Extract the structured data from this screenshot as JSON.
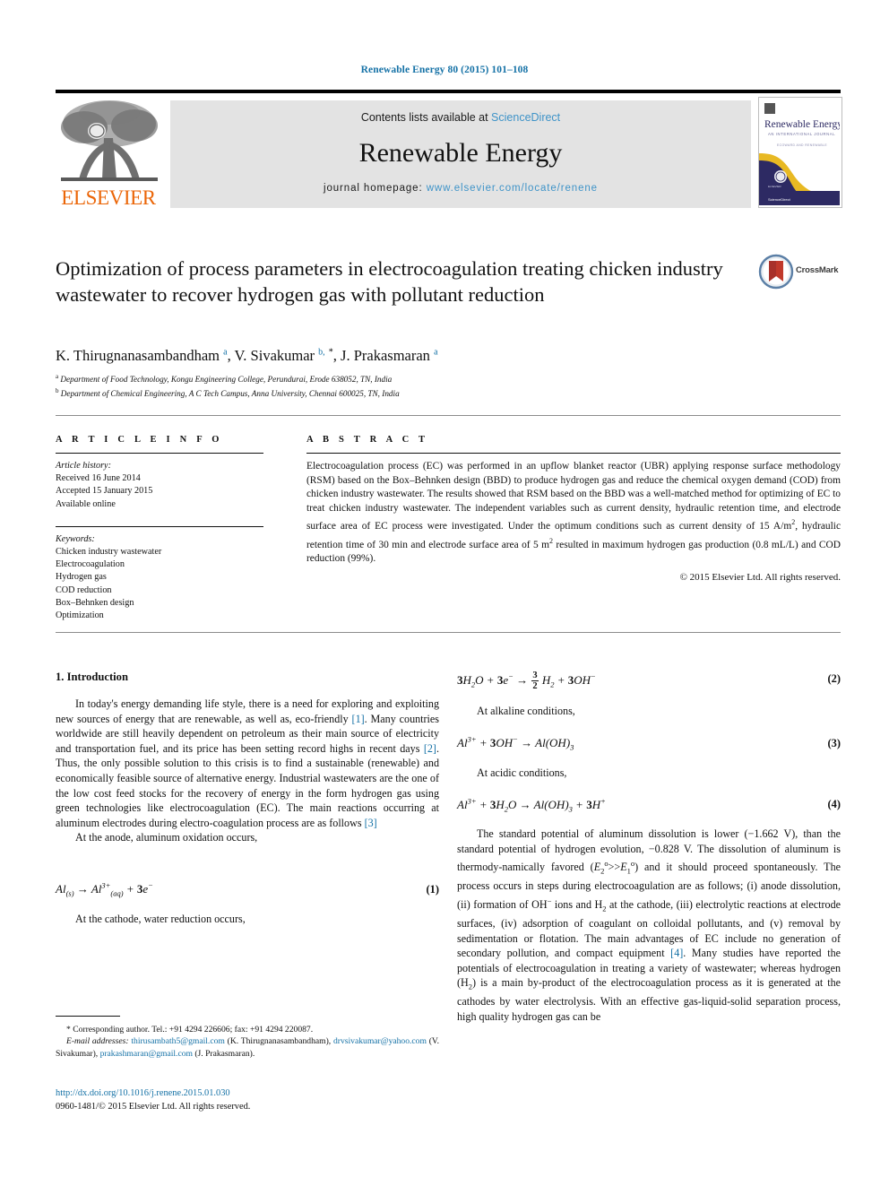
{
  "running_head": "Renewable Energy 80 (2015) 101–108",
  "masthead": {
    "publisher_name": "ELSEVIER",
    "contents_prefix": "Contents lists available at ",
    "sciencedirect": "ScienceDirect",
    "journal_title": "Renewable Energy",
    "homepage_prefix": "journal homepage: ",
    "homepage_url": "www.elsevier.com/locate/renene",
    "cover_title": "Renewable Energy",
    "cover_subtitle": "AN INTERNATIONAL JOURNAL",
    "cover_tagline": "ECOWARD AND RENEWABLE",
    "cover_footer": "ScienceDirect"
  },
  "article": {
    "title": "Optimization of process parameters in electrocoagulation treating chicken industry wastewater to recover hydrogen gas with pollutant reduction",
    "crossmark_label": "CrossMark",
    "authors_html": "K. Thirugnanasambandham <sup>a</sup>, V. Sivakumar <sup>b,</sup> <sup class=\"star\">*</sup>, J. Prakasmaran <sup>a</sup>",
    "affiliations": [
      {
        "marker": "a",
        "text": "Department of Food Technology, Kongu Engineering College, Perundurai, Erode 638052, TN, India"
      },
      {
        "marker": "b",
        "text": "Department of Chemical Engineering, A C Tech Campus, Anna University, Chennai 600025, TN, India"
      }
    ]
  },
  "article_info": {
    "heading": "A R T I C L E  I N F O",
    "history_label": "Article history:",
    "history": [
      "Received 16 June 2014",
      "Accepted 15 January 2015",
      "Available online"
    ],
    "keywords_label": "Keywords:",
    "keywords": [
      "Chicken industry wastewater",
      "Electrocoagulation",
      "Hydrogen gas",
      "COD reduction",
      "Box–Behnken design",
      "Optimization"
    ]
  },
  "abstract": {
    "heading": "A B S T R A C T",
    "body_html": "Electrocoagulation process (EC) was performed in an upflow blanket reactor (UBR) applying response surface methodology (RSM) based on the Box–Behnken design (BBD) to produce hydrogen gas and reduce the chemical oxygen demand (COD) from chicken industry wastewater. The results showed that RSM based on the BBD was a well-matched method for optimizing of EC to treat chicken industry wastewater. The independent variables such as current density, hydraulic retention time, and electrode surface area of EC process were investigated. Under the optimum conditions such as current density of 15 A/m<sup>2</sup>, hydraulic retention time of 30 min and electrode surface area of 5 m<sup>2</sup> resulted in maximum hydrogen gas production (0.8 mL/L) and COD reduction (99%).",
    "copyright": "© 2015 Elsevier Ltd. All rights reserved."
  },
  "body": {
    "section_heading": "1. Introduction",
    "intro_p1_html": "In today's energy demanding life style, there is a need for exploring and exploiting new sources of energy that are renewable, as well as, eco-friendly <span class=\"ref\">[1]</span>. Many countries worldwide are still heavily dependent on petroleum as their main source of electricity and transportation fuel, and its price has been setting record highs in recent days <span class=\"ref\">[2]</span>. Thus, the only possible solution to this crisis is to find a sustainable (renewable) and economically feasible source of alternative energy. Industrial wastewaters are the one of the low cost feed stocks for the recovery of energy in the form hydrogen gas using green technologies like electrocoagulation (EC). The main reactions occurring at aluminum electrodes during electro-coagulation process are as follows <span class=\"ref\">[3]</span>",
    "anode_lead": "At the anode, aluminum oxidation occurs,",
    "cathode_lead": "At the cathode, water reduction occurs,",
    "alkaline_lead": "At alkaline conditions,",
    "acidic_lead": "At acidic conditions,",
    "right_p_html": "The standard potential of aluminum dissolution is lower (−1.662 V), than the standard potential of hydrogen evolution, −0.828 V. The dissolution of aluminum is thermody-namically favored (<i>E</i><sub>2</sub><sup>o</sup>&gt;&gt;<i>E</i><sub>1</sub><sup>o</sup>) and it should proceed spontaneously. The process occurs in steps during electrocoagulation are as follows; (i) anode dissolution, (ii) formation of OH<sup>−</sup> ions and H<sub>2</sub> at the cathode, (iii) electrolytic reactions at electrode surfaces, (iv) adsorption of coagulant on colloidal pollutants, and (v) removal by sedimentation or flotation. The main advantages of EC include no generation of secondary pollution, and compact equipment <span class=\"ref\">[4]</span>. Many studies have reported the potentials of electrocoagulation in treating a variety of wastewater; whereas hydrogen (H<sub>2</sub>) is a main by-product of the electrocoagulation process as it is generated at the cathodes by water electrolysis. With an effective gas-liquid-solid separation process, high quality hydrogen gas can be"
  },
  "equations": [
    {
      "number": "(1)",
      "html": "<i>Al</i><sub>(<i>s</i>)</sub> &#8594; <i>Al</i><sup>3+</sup><sub>(<i>aq</i>)</sub> + <b>3</b><i>e</i><sup>−</sup>"
    },
    {
      "number": "(2)",
      "html": "<b>3</b><i>H</i><sub>2</sub><i>O</i> + <b>3</b><i>e</i><sup>−</sup> &#8594; <span class=\"frac\"><span class=\"num\">3</span><span class=\"den\">2</span></span> <i>H</i><sub>2</sub> + <b>3</b><i>OH</i><sup>−</sup>"
    },
    {
      "number": "(3)",
      "html": "<i>Al</i><sup>3+</sup> + <b>3</b><i>OH</i><sup>−</sup> &#8594; <i>Al</i>(<i>OH</i>)<sub>3</sub>"
    },
    {
      "number": "(4)",
      "html": "<i>Al</i><sup>3+</sup> + <b>3</b><i>H</i><sub>2</sub><i>O</i> &#8594; <i>Al</i>(<i>OH</i>)<sub>3</sub> + <b>3</b><i>H</i><sup>+</sup>"
    }
  ],
  "footnote": {
    "corresponding_html": "* Corresponding author. Tel.: +91 4294 226606; fax: +91 4294 220087.",
    "emails_html": "<span class=\"em\">E-mail addresses:</span> <span class=\"lnk\">thirusambath5@gmail.com</span> (K. Thirugnanasambandham), <span class=\"lnk\">drvsivakumar@yahoo.com</span> (V. Sivakumar), <span class=\"lnk\">prakashmaran@gmail.com</span> (J. Prakasmaran)."
  },
  "doi_block": {
    "doi": "http://dx.doi.org/10.1016/j.renene.2015.01.030",
    "issn_line": "0960-1481/© 2015 Elsevier Ltd. All rights reserved."
  },
  "colors": {
    "link_blue": "#1471a6",
    "sd_blue": "#3e93c8",
    "elsevier_orange": "#eb6608",
    "cover_navy": "#2d2a63",
    "cover_gold": "#e8b923",
    "crossmark_red": "#c0392b",
    "band_grey": "#e3e3e3"
  }
}
